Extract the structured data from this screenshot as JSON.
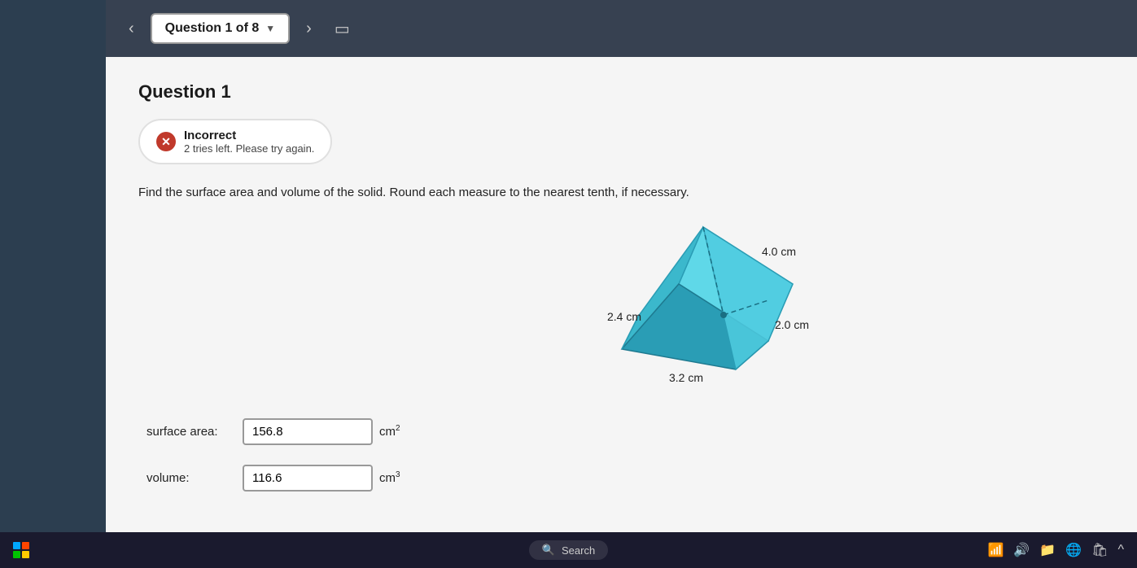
{
  "nav": {
    "back_arrow": "‹",
    "forward_arrow": "›",
    "question_label": "Question 1 of 8",
    "dropdown_arrow": "▼",
    "bookmark_icon": "🔖"
  },
  "question": {
    "title": "Question 1",
    "status": {
      "icon": "✕",
      "title": "Incorrect",
      "subtitle": "2 tries left. Please try again."
    },
    "text": "Find the surface area and volume of the solid. Round each measure to the nearest tenth, if necessary.",
    "shape": {
      "dim1": "4.0 cm",
      "dim2": "2.4 cm",
      "dim3": "2.0 cm",
      "dim4": "3.2 cm"
    },
    "fields": {
      "surface_area_label": "surface area:",
      "surface_area_value": "156.8",
      "surface_area_unit": "cm",
      "surface_area_exp": "2",
      "volume_label": "volume:",
      "volume_value": "116.6",
      "volume_unit": "cm",
      "volume_exp": "3"
    }
  },
  "taskbar": {
    "search_placeholder": "Search"
  }
}
